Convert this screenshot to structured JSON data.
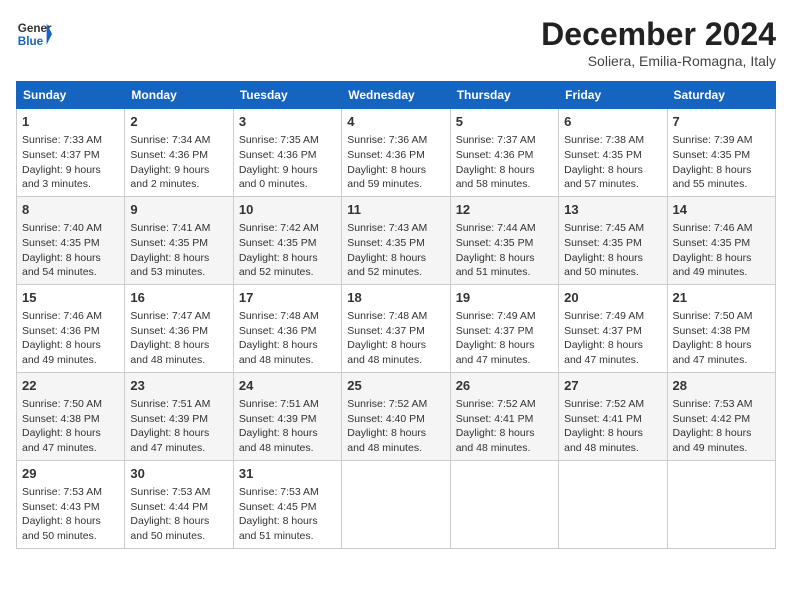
{
  "header": {
    "logo_line1": "General",
    "logo_line2": "Blue",
    "month_title": "December 2024",
    "subtitle": "Soliera, Emilia-Romagna, Italy"
  },
  "days_of_week": [
    "Sunday",
    "Monday",
    "Tuesday",
    "Wednesday",
    "Thursday",
    "Friday",
    "Saturday"
  ],
  "weeks": [
    [
      {
        "day": "1",
        "sunrise": "7:33 AM",
        "sunset": "4:37 PM",
        "daylight": "9 hours and 3 minutes."
      },
      {
        "day": "2",
        "sunrise": "7:34 AM",
        "sunset": "4:36 PM",
        "daylight": "9 hours and 2 minutes."
      },
      {
        "day": "3",
        "sunrise": "7:35 AM",
        "sunset": "4:36 PM",
        "daylight": "9 hours and 0 minutes."
      },
      {
        "day": "4",
        "sunrise": "7:36 AM",
        "sunset": "4:36 PM",
        "daylight": "8 hours and 59 minutes."
      },
      {
        "day": "5",
        "sunrise": "7:37 AM",
        "sunset": "4:36 PM",
        "daylight": "8 hours and 58 minutes."
      },
      {
        "day": "6",
        "sunrise": "7:38 AM",
        "sunset": "4:35 PM",
        "daylight": "8 hours and 57 minutes."
      },
      {
        "day": "7",
        "sunrise": "7:39 AM",
        "sunset": "4:35 PM",
        "daylight": "8 hours and 55 minutes."
      }
    ],
    [
      {
        "day": "8",
        "sunrise": "7:40 AM",
        "sunset": "4:35 PM",
        "daylight": "8 hours and 54 minutes."
      },
      {
        "day": "9",
        "sunrise": "7:41 AM",
        "sunset": "4:35 PM",
        "daylight": "8 hours and 53 minutes."
      },
      {
        "day": "10",
        "sunrise": "7:42 AM",
        "sunset": "4:35 PM",
        "daylight": "8 hours and 52 minutes."
      },
      {
        "day": "11",
        "sunrise": "7:43 AM",
        "sunset": "4:35 PM",
        "daylight": "8 hours and 52 minutes."
      },
      {
        "day": "12",
        "sunrise": "7:44 AM",
        "sunset": "4:35 PM",
        "daylight": "8 hours and 51 minutes."
      },
      {
        "day": "13",
        "sunrise": "7:45 AM",
        "sunset": "4:35 PM",
        "daylight": "8 hours and 50 minutes."
      },
      {
        "day": "14",
        "sunrise": "7:46 AM",
        "sunset": "4:35 PM",
        "daylight": "8 hours and 49 minutes."
      }
    ],
    [
      {
        "day": "15",
        "sunrise": "7:46 AM",
        "sunset": "4:36 PM",
        "daylight": "8 hours and 49 minutes."
      },
      {
        "day": "16",
        "sunrise": "7:47 AM",
        "sunset": "4:36 PM",
        "daylight": "8 hours and 48 minutes."
      },
      {
        "day": "17",
        "sunrise": "7:48 AM",
        "sunset": "4:36 PM",
        "daylight": "8 hours and 48 minutes."
      },
      {
        "day": "18",
        "sunrise": "7:48 AM",
        "sunset": "4:37 PM",
        "daylight": "8 hours and 48 minutes."
      },
      {
        "day": "19",
        "sunrise": "7:49 AM",
        "sunset": "4:37 PM",
        "daylight": "8 hours and 47 minutes."
      },
      {
        "day": "20",
        "sunrise": "7:49 AM",
        "sunset": "4:37 PM",
        "daylight": "8 hours and 47 minutes."
      },
      {
        "day": "21",
        "sunrise": "7:50 AM",
        "sunset": "4:38 PM",
        "daylight": "8 hours and 47 minutes."
      }
    ],
    [
      {
        "day": "22",
        "sunrise": "7:50 AM",
        "sunset": "4:38 PM",
        "daylight": "8 hours and 47 minutes."
      },
      {
        "day": "23",
        "sunrise": "7:51 AM",
        "sunset": "4:39 PM",
        "daylight": "8 hours and 47 minutes."
      },
      {
        "day": "24",
        "sunrise": "7:51 AM",
        "sunset": "4:39 PM",
        "daylight": "8 hours and 48 minutes."
      },
      {
        "day": "25",
        "sunrise": "7:52 AM",
        "sunset": "4:40 PM",
        "daylight": "8 hours and 48 minutes."
      },
      {
        "day": "26",
        "sunrise": "7:52 AM",
        "sunset": "4:41 PM",
        "daylight": "8 hours and 48 minutes."
      },
      {
        "day": "27",
        "sunrise": "7:52 AM",
        "sunset": "4:41 PM",
        "daylight": "8 hours and 48 minutes."
      },
      {
        "day": "28",
        "sunrise": "7:53 AM",
        "sunset": "4:42 PM",
        "daylight": "8 hours and 49 minutes."
      }
    ],
    [
      {
        "day": "29",
        "sunrise": "7:53 AM",
        "sunset": "4:43 PM",
        "daylight": "8 hours and 50 minutes."
      },
      {
        "day": "30",
        "sunrise": "7:53 AM",
        "sunset": "4:44 PM",
        "daylight": "8 hours and 50 minutes."
      },
      {
        "day": "31",
        "sunrise": "7:53 AM",
        "sunset": "4:45 PM",
        "daylight": "8 hours and 51 minutes."
      },
      null,
      null,
      null,
      null
    ]
  ],
  "labels": {
    "sunrise": "Sunrise:",
    "sunset": "Sunset:",
    "daylight": "Daylight:"
  }
}
